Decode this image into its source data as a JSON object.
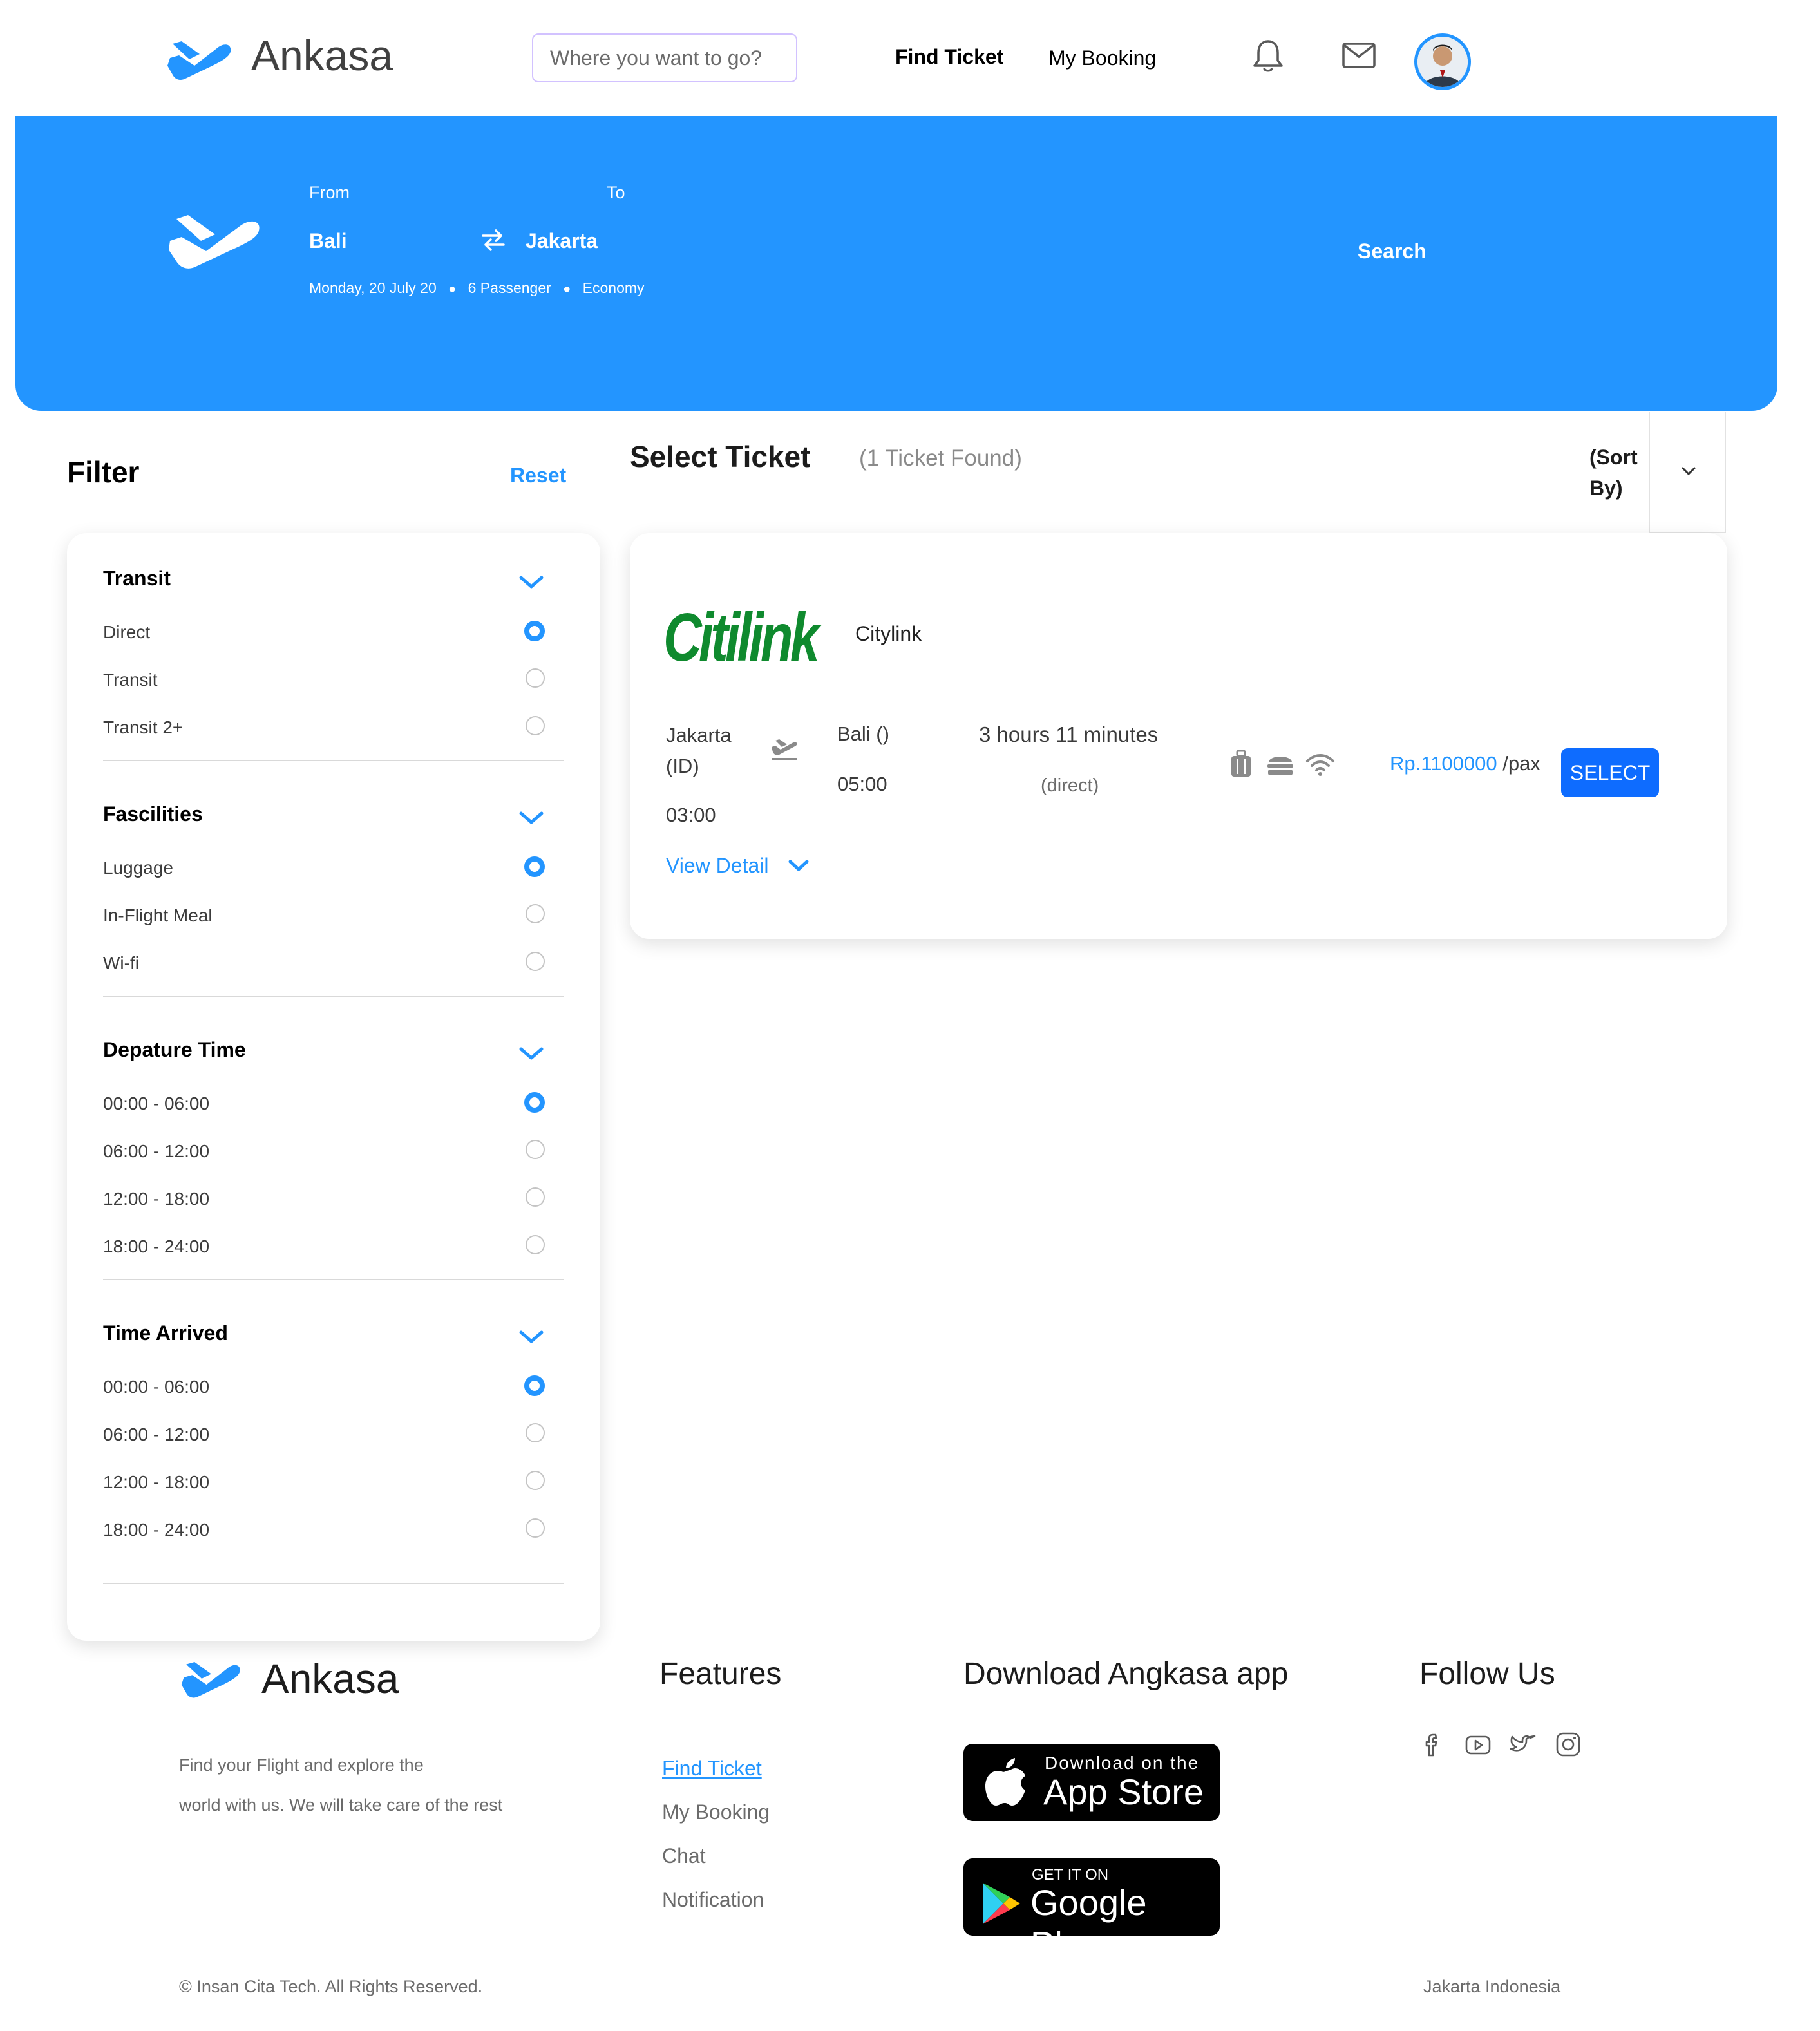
{
  "header": {
    "brand": "Ankasa",
    "search_placeholder": "Where you want to go?",
    "nav": {
      "find_ticket": "Find Ticket",
      "my_booking": "My Booking"
    }
  },
  "banner": {
    "from_label": "From",
    "to_label": "To",
    "from_city": "Bali",
    "to_city": "Jakarta",
    "date": "Monday, 20 July 20",
    "passengers": "6 Passenger",
    "class": "Economy",
    "search_label": "Search"
  },
  "filter": {
    "title": "Filter",
    "reset_label": "Reset",
    "sections": [
      {
        "title": "Transit",
        "options": [
          "Direct",
          "Transit",
          "Transit 2+"
        ],
        "selected": 0
      },
      {
        "title": "Fascilities",
        "options": [
          "Luggage",
          "In-Flight Meal",
          "Wi-fi"
        ],
        "selected": 0
      },
      {
        "title": "Depature Time",
        "options": [
          "00:00 - 06:00",
          "06:00 - 12:00",
          "12:00 - 18:00",
          "18:00 - 24:00"
        ],
        "selected": 0
      },
      {
        "title": "Time Arrived",
        "options": [
          "00:00 - 06:00",
          "06:00 - 12:00",
          "12:00 - 18:00",
          "18:00 - 24:00"
        ],
        "selected": 0
      }
    ]
  },
  "results": {
    "title": "Select Ticket",
    "count": "(1 Ticket Found)",
    "sort_line1": "(Sort",
    "sort_line2": "By)"
  },
  "ticket": {
    "airline_logo_text": "Citilink",
    "airline_name": "Citylink",
    "origin_line1": "Jakarta",
    "origin_line2": "(ID)",
    "departure_time": "03:00",
    "destination": "Bali ()",
    "arrival_time": "05:00",
    "duration": "3 hours 11 minutes",
    "route_type": "(direct)",
    "price": "Rp.1100000",
    "price_unit": "/pax",
    "select_label": "SELECT",
    "view_detail": "View Detail",
    "icons": [
      "luggage-icon",
      "meal-icon",
      "wifi-icon"
    ]
  },
  "footer": {
    "brand": "Ankasa",
    "tagline_line1": "Find your Flight and explore the",
    "tagline_line2": "world with us. We will take care of the rest",
    "features_title": "Features",
    "features": [
      "Find Ticket",
      "My Booking",
      "Chat",
      "Notification"
    ],
    "download_title": "Download Angkasa app",
    "app_store_small": "Download on the",
    "app_store_big": "App Store",
    "google_play_small": "GET IT ON",
    "google_play_big": "Google Play",
    "follow_title": "Follow Us",
    "social_icons": [
      "facebook-icon",
      "youtube-icon",
      "twitter-icon",
      "instagram-icon"
    ],
    "copyright": "© Insan Cita Tech. All Rights Reserved.",
    "location": "Jakarta Indonesia"
  },
  "colors": {
    "primary": "#2395ff",
    "button": "#0e6cff",
    "citilink_green": "#0f8a2e"
  }
}
